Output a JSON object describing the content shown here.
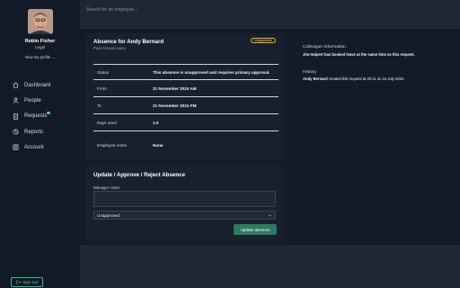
{
  "search": {
    "placeholder": "Search for an employee..."
  },
  "profile": {
    "name": "Robin Fisher",
    "role": "Legal",
    "link": "View my profile →"
  },
  "nav": {
    "items": [
      {
        "label": "Dashboard",
        "icon": "home-icon"
      },
      {
        "label": "People",
        "icon": "people-icon"
      },
      {
        "label": "Requests",
        "icon": "document-icon",
        "notification": true
      },
      {
        "label": "Reports",
        "icon": "reports-icon"
      },
      {
        "label": "Account",
        "icon": "account-icon"
      }
    ],
    "sign_out": "Sign out"
  },
  "absence": {
    "title": "Absence for Andy Bernard",
    "subtitle": "Paid Annual Leave",
    "badge": "Unapproved",
    "badge_color": "#e0b53b",
    "rows": [
      {
        "label": "Status",
        "value": "This absence is unapproved and requires primary approval."
      },
      {
        "label": "From",
        "value": "21 November 2024 AM"
      },
      {
        "label": "To",
        "value": "21 November 2024 PM"
      },
      {
        "label": "Days used",
        "value": "1.0"
      },
      {
        "label": "Employee notes",
        "value": "None"
      }
    ]
  },
  "update": {
    "title": "Update / Approve / Reject Absence",
    "notes_label": "Manager notes",
    "notes_value": "",
    "select_value": "Unapproved",
    "button": "Update absence",
    "button_color": "#2d7a62"
  },
  "side_info": {
    "colleague_title": "Colleague Information",
    "colleague_text": "Jim Halpert has booked leave at the same time as this request.",
    "history_title": "History",
    "history_name": "Andy Bernard",
    "history_text": " created this request at 20:11 on 15 July 2024"
  }
}
